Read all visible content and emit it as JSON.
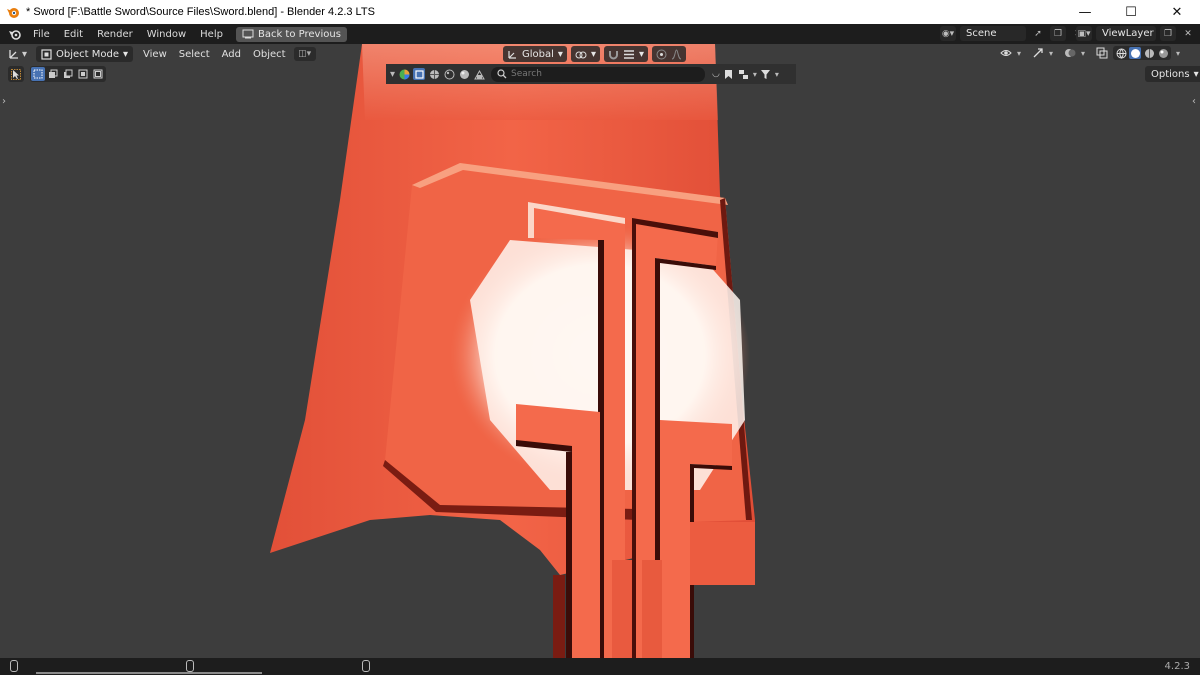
{
  "window": {
    "title": "* Sword [F:\\Battle Sword\\Source Files\\Sword.blend] - Blender 4.2.3 LTS",
    "buttons": [
      "minimize",
      "maximize",
      "close"
    ]
  },
  "topbar": {
    "menus": [
      "File",
      "Edit",
      "Render",
      "Window",
      "Help"
    ],
    "back_label": "Back to Previous",
    "scene_name": "Scene",
    "view_layer_name": "ViewLayer"
  },
  "viewport_header": {
    "mode": "Object Mode",
    "menus": [
      "View",
      "Select",
      "Add",
      "Object"
    ],
    "transform_orientation": "Global",
    "search_placeholder": "Search",
    "options_label": "Options"
  },
  "statusbar": {
    "version": "4.2.3"
  },
  "colors": {
    "blade": "#e8553c",
    "blade_light": "#f47a5e",
    "glow": "#fff4ee",
    "viewport_bg": "#3d3d3d",
    "accent_blue": "#4772b3"
  }
}
